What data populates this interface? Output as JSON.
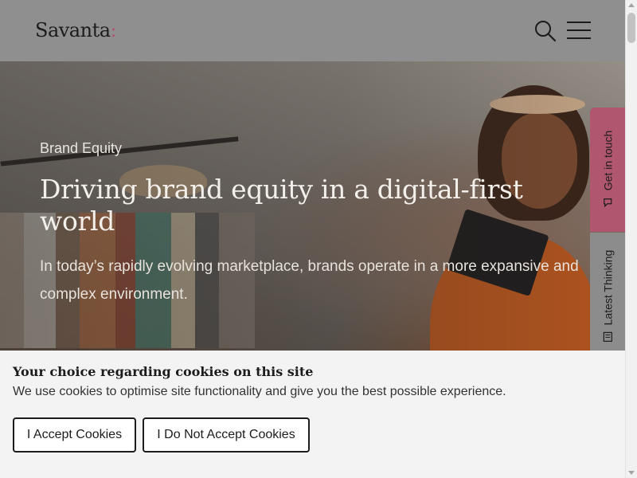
{
  "header": {
    "logo_text": "Savanta",
    "logo_mark": ":",
    "search_icon": "search-icon",
    "menu_icon": "hamburger-menu-icon"
  },
  "hero": {
    "eyebrow": "Brand Equity",
    "title": "Driving brand equity in a digital-first world",
    "subtitle": "In today’s rapidly evolving marketplace, brands operate in a more expansive and complex environment."
  },
  "side_tabs": {
    "contact_label": "Get in touch",
    "contact_icon": "chat-bubble-icon",
    "thinking_label": "Latest Thinking",
    "thinking_icon": "document-icon"
  },
  "cookie_banner": {
    "title": "Your choice regarding cookies on this site",
    "text": "We use cookies to optimise site functionality and give you the best possible experience.",
    "accept_label": "I Accept Cookies",
    "decline_label": "I Do Not Accept Cookies"
  },
  "colors": {
    "brand_accent": "#b0566f",
    "header_bg": "#8f8f8f",
    "banner_bg": "#f3f3f3"
  }
}
